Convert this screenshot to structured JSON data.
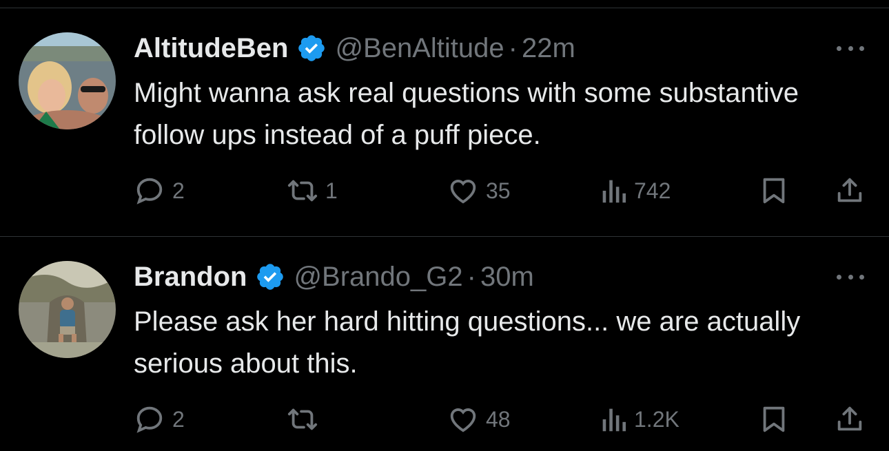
{
  "tweets": [
    {
      "display_name": "AltitudeBen",
      "handle": "@BenAltitude",
      "separator": "·",
      "time": "22m",
      "text": "Might wanna ask real questions with some substantive follow ups instead of a puff piece.",
      "replies": "2",
      "retweets": "1",
      "likes": "35",
      "views": "742"
    },
    {
      "display_name": "Brandon",
      "handle": "@Brando_G2",
      "separator": "·",
      "time": "30m",
      "text": "Please ask her hard hitting questions... we are actually serious about this.",
      "replies": "2",
      "retweets": "",
      "likes": "48",
      "views": "1.2K"
    }
  ],
  "colors": {
    "background": "#000000",
    "primary_text": "#e7e9ea",
    "secondary_text": "#71767b",
    "verified_blue": "#1d9bf0",
    "divider": "#2f3336"
  },
  "icons": {
    "reply": "reply-icon",
    "retweet": "retweet-icon",
    "like": "heart-icon",
    "views": "views-icon",
    "bookmark": "bookmark-icon",
    "share": "share-icon",
    "verified": "verified-badge-icon",
    "more": "more-options-icon"
  }
}
